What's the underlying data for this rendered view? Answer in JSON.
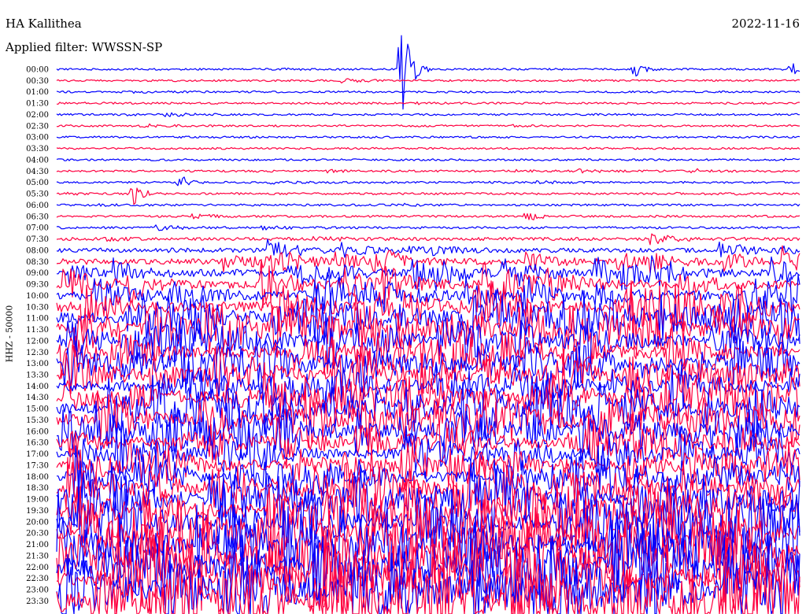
{
  "header": {
    "station": "HA Kallithea",
    "date": "2022-11-16",
    "filter": "Applied filter: WWSSN-SP"
  },
  "chart_data": {
    "type": "line",
    "title": "HA Kallithea",
    "subtitle": "Applied filter: WWSSN-SP",
    "ylabel": "HHZ - 50000",
    "date": "2022-11-16",
    "row_labels": [
      "00:00",
      "00:30",
      "01:00",
      "01:30",
      "02:00",
      "02:30",
      "03:00",
      "03:30",
      "04:00",
      "04:30",
      "05:00",
      "05:30",
      "06:00",
      "06:30",
      "07:00",
      "07:30",
      "08:00",
      "08:30",
      "09:00",
      "09:30",
      "10:00",
      "10:30",
      "11:00",
      "11:30",
      "12:00",
      "12:30",
      "13:00",
      "13:30",
      "14:00",
      "14:30",
      "15:00",
      "15:30",
      "16:00",
      "16:30",
      "17:00",
      "17:30",
      "18:00",
      "18:30",
      "19:00",
      "19:30",
      "20:00",
      "20:30",
      "21:00",
      "21:30",
      "22:00",
      "22:30",
      "23:00",
      "23:30"
    ],
    "row_minutes": 30,
    "series": [
      {
        "color": "#0000ff"
      },
      {
        "color": "#ff0040"
      }
    ],
    "activity_level": [
      0.12,
      0.12,
      0.12,
      0.12,
      0.12,
      0.12,
      0.13,
      0.13,
      0.14,
      0.15,
      0.15,
      0.15,
      0.16,
      0.18,
      0.25,
      0.45,
      0.85,
      1.2,
      1.5,
      1.8,
      2.2,
      2.5,
      2.7,
      2.8,
      2.8,
      2.7,
      2.7,
      2.6,
      2.6,
      2.6,
      2.7,
      2.7,
      2.5,
      2.4,
      2.3,
      2.4,
      2.5,
      2.7,
      3.0,
      3.3,
      3.6,
      4.0,
      4.3,
      4.6,
      4.9,
      5.2,
      5.4,
      5.6
    ],
    "events": [
      {
        "row": 0,
        "minute": 13.9,
        "amplitude": 75
      },
      {
        "row": 0,
        "minute": 23.3,
        "amplitude": 10
      },
      {
        "row": 0,
        "minute": 29.6,
        "amplitude": 8
      },
      {
        "row": 10,
        "minute": 5.0,
        "amplitude": 9
      },
      {
        "row": 11,
        "minute": 3.1,
        "amplitude": 16
      },
      {
        "row": 13,
        "minute": 19.0,
        "amplitude": 9
      }
    ],
    "grid": false,
    "legend": "none"
  }
}
